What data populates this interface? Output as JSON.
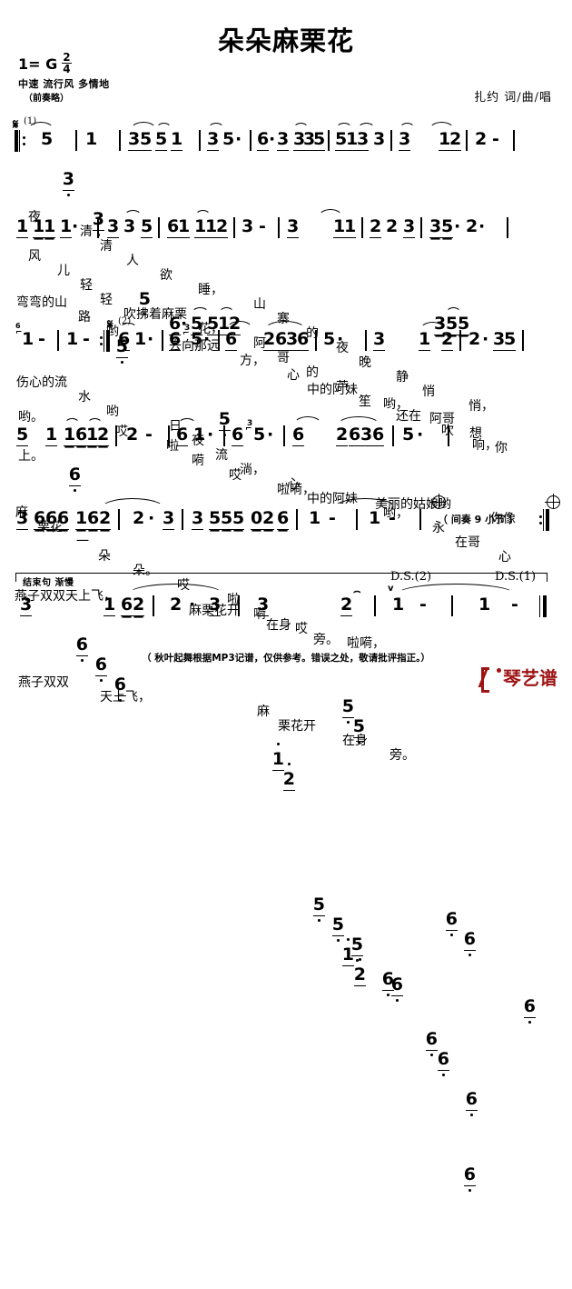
{
  "header": {
    "title": "朵朵麻栗花",
    "key_label": "1= G",
    "meter_num": "2",
    "meter_den": "4",
    "tempo": "中速 流行风 多情地",
    "prelude": "（前奏略）",
    "author": "扎约  词/曲/唱"
  },
  "marks": {
    "segno1": "(1)",
    "segno2": "(2)",
    "segno_glyph": "𝄋",
    "coda_glyph": "⊕",
    "ds2": "D.S.(2)",
    "ds1": "D.S.(1)",
    "interlude": "（ 间奏 9 小节 ）",
    "ending_label": "结束句  渐慢",
    "grace3": "3",
    "fermata": "⌢",
    "breath": "v"
  },
  "lines": [
    {
      "id": "line1",
      "notes": "3 5 3 | 1 5 | 35 5 15 | 3 5· | 6·3 335 | 513 3 | 36 612 | 2 -",
      "lyrics1": "夜    清清 人  欲  睡，  山寨 的  夜晚  静悄  悄，",
      "lyrics2": "风 儿 轻轻 吹拂着麻栗 花，  阿哥 的  芦笙  还在 吹 响，"
    },
    {
      "id": "line2",
      "notes": "1 11 1·5 | 3 3 5 | 61 112 | 3 - | 3 55 11 | 2 2 3 | 35· 2·6",
      "alt_notes": "6·5 512",
      "alt_notes2": "355",
      "lyrics1": "弯弯的山 路 哟   去向那远  方，  心 中的阿妹 哟，   阿哥 想 你",
      "lyrics2": "伤心的流 水 哟   日 夜 流  淌，  心 中的阿妹 哟，   永 在哥 心"
    },
    {
      "id": "line3",
      "notes": "1 - | 1 - :‖ 6 1· | 6 5· | 612 2636 | 5·6 | 3 66 162 | 2· 35",
      "lyrics1": "哟。      哎   啦 嗬  哎   啦嗬，     美丽的姑娘哟    你像",
      "lyrics2": "上。"
    },
    {
      "id": "line4",
      "notes": "5 6 1 1 612 | 2 - | 6 1· | 6 5· | 612 2636 | 5·6",
      "lyrics1": "麻 栗花 一 朵  朵。  哎   啦 嗬  哎   啦嗬，"
    },
    {
      "id": "line5",
      "notes": "3 666 162 | 2·3 | 3 555 026 | 1 - | 1 -",
      "lyrics1": "燕子双双天上飞，    麻栗花开 在身 旁。"
    },
    {
      "id": "line6",
      "notes": "3 6 6 6 1 62 | 2 · 3 | 3 5 5 5 2 6 | 1 - | 1 -",
      "lyrics1": "燕子双双 天上飞，     麻 栗花开 在身  旁。"
    }
  ],
  "footnote": "（ 秋叶起舞根据MP3记谱，仅供参考。错误之处，敬请批评指正。）",
  "logo": {
    "text": "琴艺谱",
    "color": "#9e1414"
  }
}
